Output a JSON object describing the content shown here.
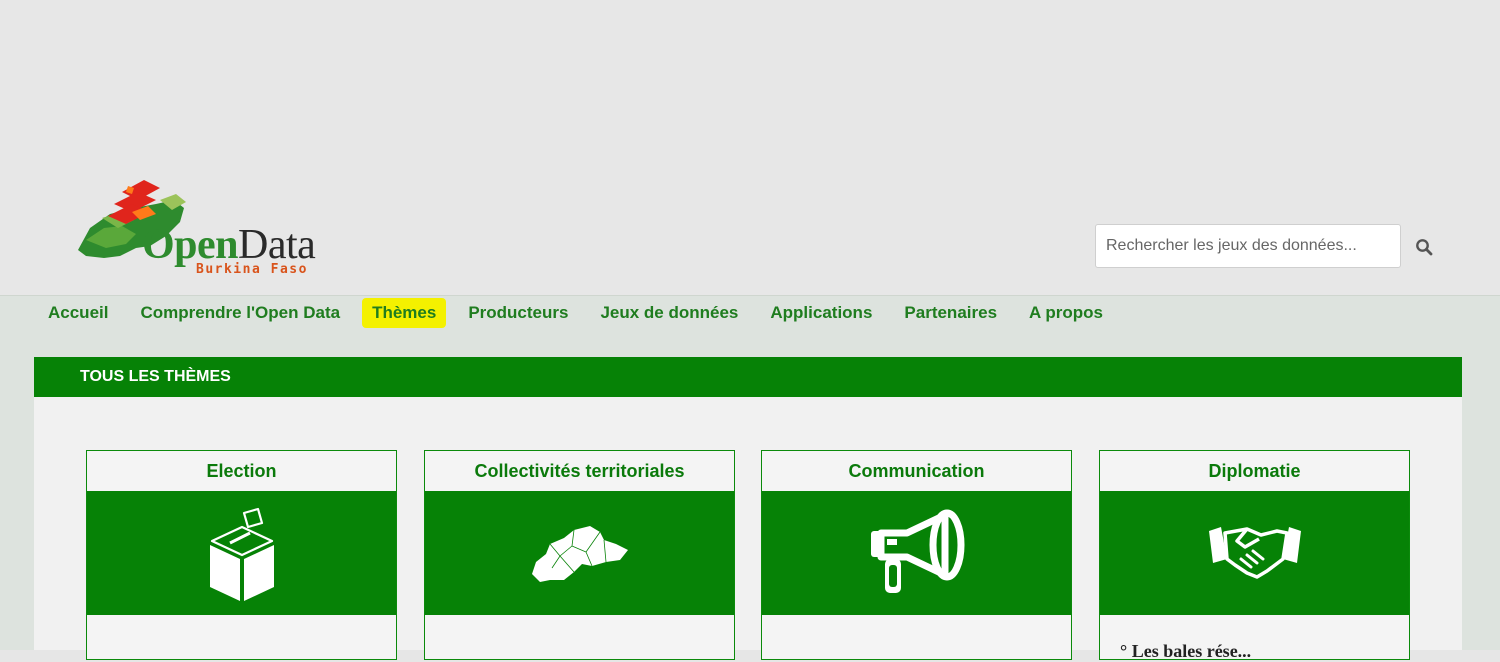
{
  "logo": {
    "name_open": "Open",
    "name_data": "Data",
    "subtitle": "Burkina Faso"
  },
  "search": {
    "placeholder": "Rechercher les jeux des données..."
  },
  "nav": {
    "items": [
      {
        "label": "Accueil",
        "active": false
      },
      {
        "label": "Comprendre l'Open Data",
        "active": false
      },
      {
        "label": "Thèmes",
        "active": true
      },
      {
        "label": "Producteurs",
        "active": false
      },
      {
        "label": "Jeux de données",
        "active": false
      },
      {
        "label": "Applications",
        "active": false
      },
      {
        "label": "Partenaires",
        "active": false
      },
      {
        "label": "A propos",
        "active": false
      }
    ]
  },
  "section": {
    "title": "TOUS LES THÈMES"
  },
  "themes": [
    {
      "title": "Election",
      "icon": "ballot-box-icon"
    },
    {
      "title": "Collectivités territoriales",
      "icon": "burkina-map-icon"
    },
    {
      "title": "Communication",
      "icon": "megaphone-icon"
    },
    {
      "title": "Diplomatie",
      "icon": "handshake-icon",
      "excerpt": "° Les bales rése..."
    }
  ],
  "colors": {
    "brand_green": "#068206",
    "active_nav": "#f4f100",
    "logo_orange": "#d9541c"
  }
}
